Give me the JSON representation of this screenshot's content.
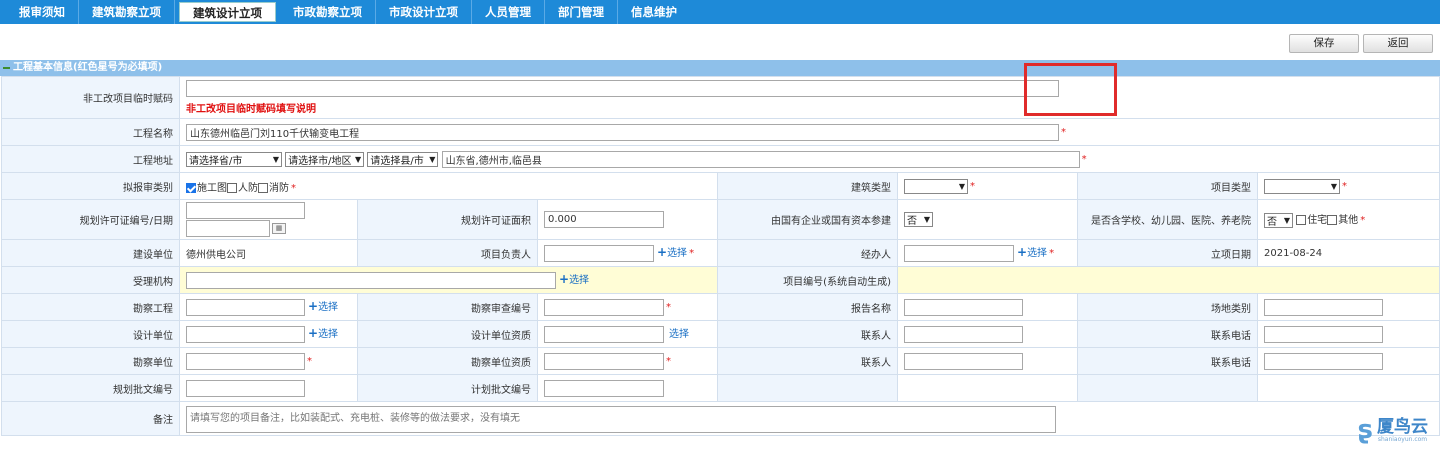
{
  "nav": {
    "items": [
      {
        "label": "报审须知",
        "active": false
      },
      {
        "label": "建筑勘察立项",
        "active": false
      },
      {
        "label": "建筑设计立项",
        "active": true
      },
      {
        "label": "市政勘察立项",
        "active": false
      },
      {
        "label": "市政设计立项",
        "active": false
      },
      {
        "label": "人员管理",
        "active": false
      },
      {
        "label": "部门管理",
        "active": false
      },
      {
        "label": "信息维护",
        "active": false
      }
    ]
  },
  "toolbar": {
    "save_label": "保存",
    "back_label": "返回"
  },
  "section": {
    "title": "工程基本信息(红色星号为必填项)"
  },
  "form": {
    "temp_code": {
      "label": "非工改项目临时赋码",
      "value": "",
      "hint": "非工改项目临时赋码填写说明"
    },
    "project_name": {
      "label": "工程名称",
      "value": "山东德州临邑门刘110千伏输变电工程"
    },
    "address": {
      "label": "工程地址",
      "province": "请选择省/市",
      "city": "请选择市/地区",
      "county": "请选择县/市",
      "detail": "山东省,德州市,临邑县"
    },
    "review_type": {
      "label": "拟报审类别",
      "options": [
        {
          "label": "施工图",
          "checked": true
        },
        {
          "label": "人防",
          "checked": false
        },
        {
          "label": "消防",
          "checked": false
        }
      ]
    },
    "building_type": {
      "label": "建筑类型",
      "value": ""
    },
    "project_type": {
      "label": "项目类型",
      "value": ""
    },
    "permit_no": {
      "label": "规划许可证编号/日期",
      "value": "",
      "date": "",
      "calendar_icon": "calendar-icon"
    },
    "permit_area": {
      "label": "规划许可证面积",
      "value": "0.000"
    },
    "state_owned": {
      "label": "由国有企业或国有资本参建",
      "value": "否"
    },
    "school": {
      "label": "是否含学校、幼儿园、医院、养老院",
      "value": "否",
      "options": [
        {
          "label": "住宅",
          "checked": false
        },
        {
          "label": "其他",
          "checked": false
        }
      ]
    },
    "build_unit": {
      "label": "建设单位",
      "value": "德州供电公司"
    },
    "project_leader": {
      "label": "项目负责人",
      "value": ""
    },
    "handler": {
      "label": "经办人",
      "value": ""
    },
    "setup_date": {
      "label": "立项日期",
      "value": "2021-08-24"
    },
    "accept_org": {
      "label": "受理机构",
      "value": ""
    },
    "project_no": {
      "label": "项目编号(系统自动生成)",
      "value": ""
    },
    "survey_project": {
      "label": "勘察工程",
      "value": ""
    },
    "survey_review_no": {
      "label": "勘察审查编号",
      "value": ""
    },
    "report_name": {
      "label": "报告名称",
      "value": ""
    },
    "site_type": {
      "label": "场地类别",
      "value": ""
    },
    "design_unit": {
      "label": "设计单位",
      "value": ""
    },
    "design_qual": {
      "label": "设计单位资质",
      "value": ""
    },
    "contact1": {
      "label": "联系人",
      "value": ""
    },
    "phone1": {
      "label": "联系电话",
      "value": ""
    },
    "survey_unit": {
      "label": "勘察单位",
      "value": ""
    },
    "survey_qual": {
      "label": "勘察单位资质",
      "value": ""
    },
    "contact2": {
      "label": "联系人",
      "value": ""
    },
    "phone2": {
      "label": "联系电话",
      "value": ""
    },
    "plan_doc_no": {
      "label": "规划批文编号",
      "value": ""
    },
    "plan_approval_no": {
      "label": "计划批文编号",
      "value": ""
    },
    "remark": {
      "label": "备注",
      "placeholder": "请填写您的项目备注，比如装配式、充电桩、装修等的做法要求，没有填无"
    }
  },
  "common": {
    "select_label": "选择",
    "plus": "+",
    "required": "*"
  },
  "watermark": {
    "main": "厦鸟云",
    "sub": "shaniaoyun.com"
  },
  "colors": {
    "nav_bg": "#1e8ad8",
    "section_bg": "#8ec0ea",
    "label_bg": "#eef5fd",
    "highlight_bg": "#fffdd6",
    "required": "#e02020",
    "annotation_box": "#e02b2b"
  }
}
